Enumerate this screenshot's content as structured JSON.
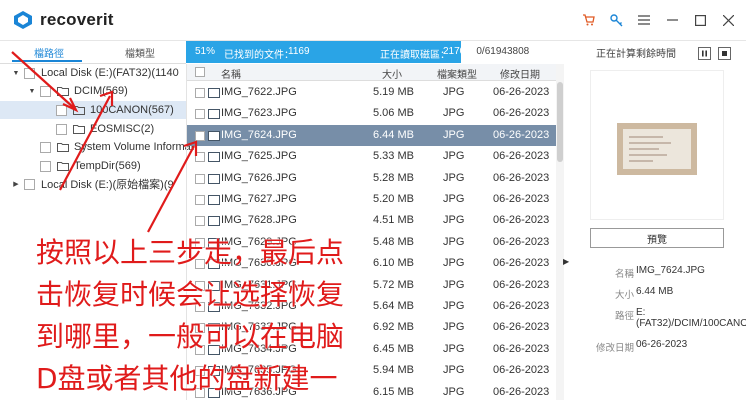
{
  "app": {
    "name": "recoverit",
    "colors": {
      "accent": "#1a85d6",
      "progress": "#2aa4e6",
      "selected_row": "#778ea8",
      "annotation": "#e01b1b"
    }
  },
  "titlebar": {
    "icons": [
      "cart-icon",
      "key-icon",
      "menu-icon",
      "minimize-icon",
      "maximize-icon",
      "close-icon"
    ]
  },
  "sidebar": {
    "tabs": [
      {
        "label": "檔路徑",
        "active": true
      },
      {
        "label": "檔類型",
        "active": false
      }
    ],
    "tree": [
      {
        "label": "Local Disk (E:)(FAT32)(1140",
        "expanded": true,
        "selected": false
      },
      {
        "label": "DCIM(569)",
        "expanded": true,
        "selected": false
      },
      {
        "label": "100CANON(567)",
        "expanded": false,
        "selected": true
      },
      {
        "label": "EOSMISC(2)",
        "expanded": false,
        "selected": false
      },
      {
        "label": "System Volume Informat",
        "expanded": false,
        "selected": false
      },
      {
        "label": "TempDir(569)",
        "expanded": false,
        "selected": false
      },
      {
        "label": "Local Disk (E:)(原始檔案)(9",
        "expanded": false,
        "selected": false
      }
    ]
  },
  "scan": {
    "percent_label": "51%",
    "progress": 0.51,
    "found_label": "已找到的文件：",
    "found_count": "1169",
    "reading_label": "正在讀取磁區：",
    "sectors": "2170880/61943808",
    "remaining_label": "正在計算剩餘時間"
  },
  "filelist": {
    "headers": {
      "name": "名稱",
      "size": "大小",
      "type": "檔案類型",
      "date": "修改日期"
    },
    "rows": [
      {
        "name": "IMG_7622.JPG",
        "size": "5.19  MB",
        "type": "JPG",
        "date": "06-26-2023",
        "selected": false
      },
      {
        "name": "IMG_7623.JPG",
        "size": "5.06  MB",
        "type": "JPG",
        "date": "06-26-2023",
        "selected": false
      },
      {
        "name": "IMG_7624.JPG",
        "size": "6.44  MB",
        "type": "JPG",
        "date": "06-26-2023",
        "selected": true
      },
      {
        "name": "IMG_7625.JPG",
        "size": "5.33  MB",
        "type": "JPG",
        "date": "06-26-2023",
        "selected": false
      },
      {
        "name": "IMG_7626.JPG",
        "size": "5.28  MB",
        "type": "JPG",
        "date": "06-26-2023",
        "selected": false
      },
      {
        "name": "IMG_7627.JPG",
        "size": "5.20  MB",
        "type": "JPG",
        "date": "06-26-2023",
        "selected": false
      },
      {
        "name": "IMG_7628.JPG",
        "size": "4.51  MB",
        "type": "JPG",
        "date": "06-26-2023",
        "selected": false
      },
      {
        "name": "IMG_7629.JPG",
        "size": "5.48  MB",
        "type": "JPG",
        "date": "06-26-2023",
        "selected": false
      },
      {
        "name": "IMG_7630.JPG",
        "size": "6.10  MB",
        "type": "JPG",
        "date": "06-26-2023",
        "selected": false
      },
      {
        "name": "IMG_7631.JPG",
        "size": "5.72  MB",
        "type": "JPG",
        "date": "06-26-2023",
        "selected": false
      },
      {
        "name": "IMG_7632.JPG",
        "size": "5.64  MB",
        "type": "JPG",
        "date": "06-26-2023",
        "selected": false
      },
      {
        "name": "IMG_7633.JPG",
        "size": "6.92  MB",
        "type": "JPG",
        "date": "06-26-2023",
        "selected": false
      },
      {
        "name": "IMG_7634.JPG",
        "size": "6.45  MB",
        "type": "JPG",
        "date": "06-26-2023",
        "selected": false
      },
      {
        "name": "IMG_7635.JPG",
        "size": "5.94  MB",
        "type": "JPG",
        "date": "06-26-2023",
        "selected": false
      },
      {
        "name": "IMG_7636.JPG",
        "size": "6.15  MB",
        "type": "JPG",
        "date": "06-26-2023",
        "selected": false
      }
    ]
  },
  "preview": {
    "button_label": "預覽",
    "meta": [
      {
        "key": "名稱",
        "value": "IMG_7624.JPG"
      },
      {
        "key": "大小",
        "value": "6.44 MB"
      },
      {
        "key": "路徑",
        "value": "E:(FAT32)/DCIM/100CANON"
      },
      {
        "key": "修改日期",
        "value": "06-26-2023"
      }
    ]
  },
  "annotation": {
    "lines": [
      "按照以上三步走，最后点",
      "击恢复时候会让选择恢复",
      "到哪里，一般可以在电脑",
      "D盘或者其他的盘新建一"
    ]
  }
}
